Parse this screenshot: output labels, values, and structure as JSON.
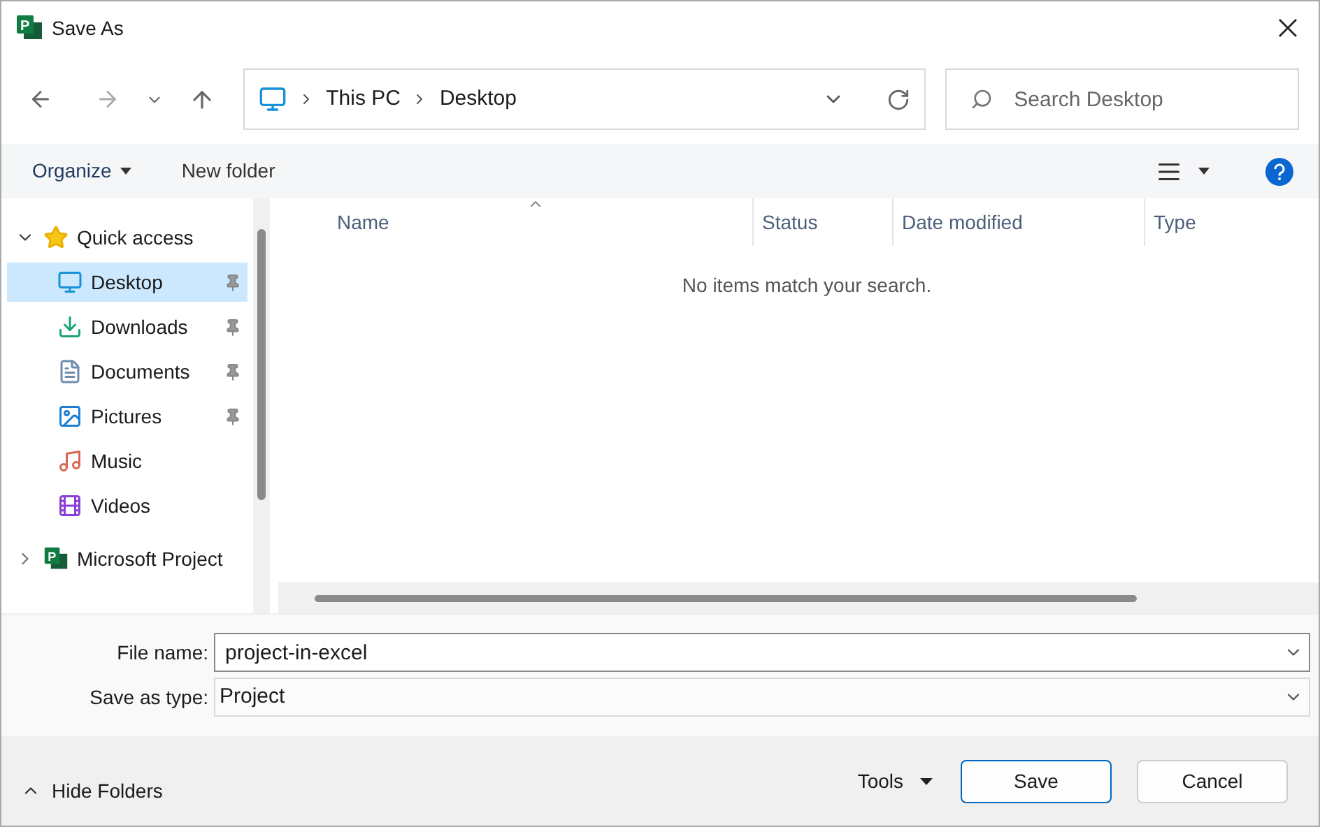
{
  "window": {
    "title": "Save As",
    "icon_letter": "P"
  },
  "address": {
    "crumbs": [
      "This PC",
      "Desktop"
    ]
  },
  "search": {
    "placeholder": "Search Desktop"
  },
  "toolbar": {
    "organize": "Organize",
    "new_folder": "New folder"
  },
  "nav": [
    {
      "label": "Quick access",
      "kind": "group",
      "expanded": true,
      "selected": false,
      "children": [
        {
          "label": "Desktop",
          "kind": "desktop",
          "pinned": true,
          "selected": true
        },
        {
          "label": "Downloads",
          "kind": "downloads",
          "pinned": true,
          "selected": false
        },
        {
          "label": "Documents",
          "kind": "documents",
          "pinned": true,
          "selected": false
        },
        {
          "label": "Pictures",
          "kind": "pictures",
          "pinned": true,
          "selected": false
        },
        {
          "label": "Music",
          "kind": "music",
          "pinned": false,
          "selected": false
        },
        {
          "label": "Videos",
          "kind": "videos",
          "pinned": false,
          "selected": false
        }
      ]
    },
    {
      "label": "Microsoft Project",
      "kind": "project",
      "icon_letter": "P",
      "expanded": false,
      "selected": false
    }
  ],
  "table": {
    "columns": [
      "Name",
      "Status",
      "Date modified",
      "Type"
    ],
    "empty_message": "No items match your search."
  },
  "form": {
    "file_name_label": "File name:",
    "file_name": "project-in-excel",
    "type_label": "Save as type:",
    "type": "Project"
  },
  "footer": {
    "hide_folders": "Hide Folders",
    "tools": "Tools",
    "save": "Save",
    "cancel": "Cancel"
  }
}
